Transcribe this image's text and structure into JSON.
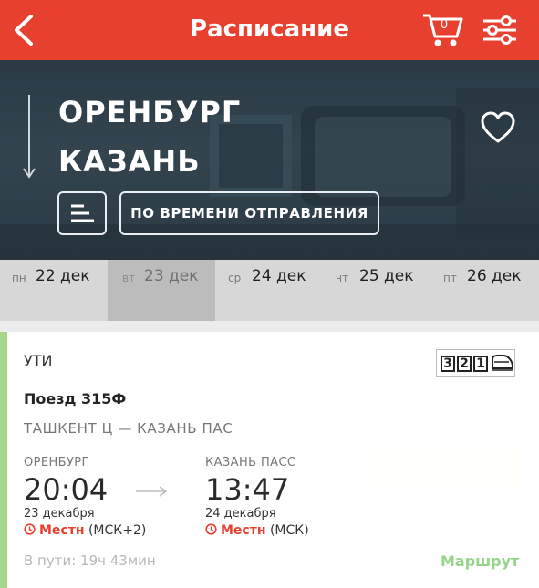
{
  "header": {
    "title": "Расписание",
    "cart_count": "0",
    "back_icon": "chevron-left-icon",
    "cart_icon": "cart-icon",
    "filter_icon": "sliders-icon"
  },
  "route": {
    "from": "ОРЕНБУРГ",
    "to": "КАЗАНЬ",
    "sort_icon": "sort-lines-icon",
    "order_label": "ПО ВРЕМЕНИ ОТПРАВЛЕНИЯ",
    "favorite_icon": "heart-icon"
  },
  "dates": [
    {
      "weekday": "пн",
      "day": "22 дек",
      "selected": false
    },
    {
      "weekday": "вт",
      "day": "23 дек",
      "selected": true
    },
    {
      "weekday": "ср",
      "day": "24 дек",
      "selected": false
    },
    {
      "weekday": "чт",
      "day": "25 дек",
      "selected": false
    },
    {
      "weekday": "пт",
      "day": "26 дек",
      "selected": false
    }
  ],
  "train": {
    "operator": "УТИ",
    "classes": [
      "3",
      "2",
      "1"
    ],
    "number": "Поезд 315Ф",
    "route": "ТАШКЕНТ Ц — КАЗАНЬ ПАС",
    "departure": {
      "station": "ОРЕНБУРГ",
      "time": "20:04",
      "date": "23 декабря",
      "tz_label": "Местн",
      "tz_note": "(МСК+2)"
    },
    "arrival": {
      "station": "КАЗАНЬ ПАСС",
      "time": "13:47",
      "date": "24 декабря",
      "tz_label": "Местн",
      "tz_note": "(МСК)"
    },
    "duration": "В пути: 19ч 43мин",
    "route_link": "Маршрут"
  },
  "colors": {
    "accent": "#e8402f",
    "route_link": "#97d58a",
    "card_strip": "#a5d68b"
  }
}
